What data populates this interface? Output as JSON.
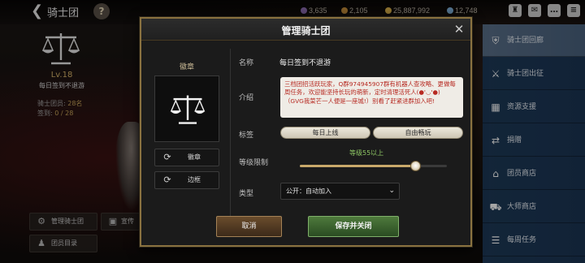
{
  "topbar": {
    "title": "骑士团",
    "help": "?",
    "currencies": [
      {
        "value": "3,635",
        "color": "#8b6ab0"
      },
      {
        "value": "2,105",
        "color": "#c08a3a"
      },
      {
        "value": "25,887,992",
        "color": "#d8b04a"
      },
      {
        "value": "12,748",
        "color": "#7fb0d8"
      }
    ],
    "icons": [
      "guild-members-icon",
      "mail-icon",
      "chat-icon",
      "menu-icon"
    ]
  },
  "left_panel": {
    "level": "Lv.18",
    "guild_name": "每日签到不退游",
    "members_label": "骑士团员:",
    "members_value": "28名",
    "signin_label": "签到:",
    "signin_value": "0 / 28",
    "manage_button": "管理骑士团",
    "roster_button": "团员目录",
    "partial_button": "宣传"
  },
  "sidebar": {
    "items": [
      {
        "label": "骑士团回廊",
        "icon": "shield-icon",
        "active": true
      },
      {
        "label": "骑士团出征",
        "icon": "swords-icon",
        "active": false
      },
      {
        "label": "资源支援",
        "icon": "box-icon",
        "active": false
      },
      {
        "label": "捐赠",
        "icon": "shuffle-icon",
        "active": false
      },
      {
        "label": "团员商店",
        "icon": "shop-icon",
        "active": false
      },
      {
        "label": "大师商店",
        "icon": "cart-icon",
        "active": false
      },
      {
        "label": "每周任务",
        "icon": "scroll-icon",
        "active": false
      }
    ]
  },
  "modal": {
    "title": "管理骑士团",
    "close": "✕",
    "badge_label": "徽章",
    "emblem_button": "徽章",
    "frame_button": "边框",
    "name_label": "名称",
    "name_value": "每日签到不退游",
    "intro_label": "介绍",
    "intro_text": "三档团招活跃玩家，Q群974945907群有机器人查攻略、更做每周任务，欢迎能坚持长玩的萌新，定时清理活死人(●'◡'●)（GVG我菜芒一人便是一座城!）别看了赶紧进群加入吧!",
    "tags_label": "标签",
    "tags": [
      "每日上线",
      "自由畅玩"
    ],
    "level_label": "等级限制",
    "level_text": "等级55以上",
    "level_min": 1,
    "level_max": 70,
    "level_value": 55,
    "type_label": "类型",
    "type_value": "公开：自动加入",
    "cancel_label": "取消",
    "save_label": "保存并关闭"
  }
}
